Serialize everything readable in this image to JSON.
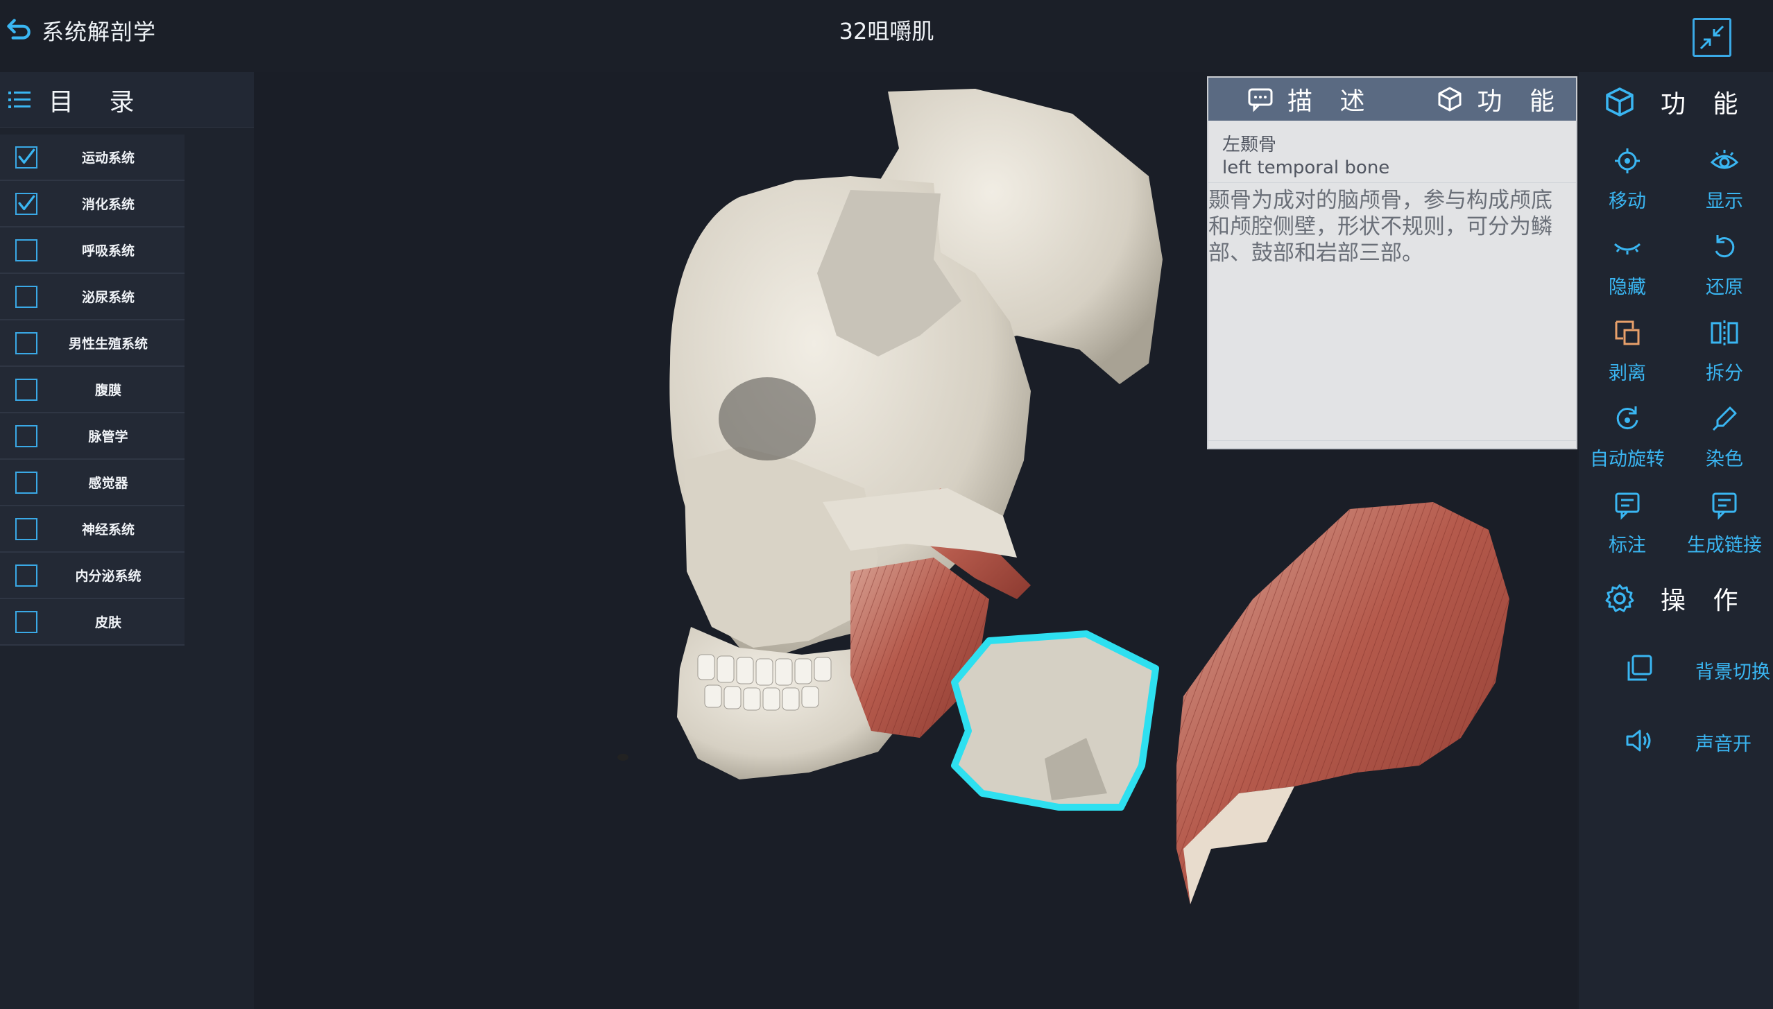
{
  "header": {
    "app_title": "系统解剖学",
    "page_title": "32咀嚼肌"
  },
  "toc": {
    "title": "目 录",
    "items": [
      {
        "label": "运动系统",
        "checked": true
      },
      {
        "label": "消化系统",
        "checked": true
      },
      {
        "label": "呼吸系统",
        "checked": false
      },
      {
        "label": "泌尿系统",
        "checked": false
      },
      {
        "label": "男性生殖系统",
        "checked": false
      },
      {
        "label": "腹膜",
        "checked": false
      },
      {
        "label": "脉管学",
        "checked": false
      },
      {
        "label": "感觉器",
        "checked": false
      },
      {
        "label": "神经系统",
        "checked": false
      },
      {
        "label": "内分泌系统",
        "checked": false
      },
      {
        "label": "皮肤",
        "checked": false
      }
    ]
  },
  "description": {
    "tabs": [
      "描 述",
      "功 能"
    ],
    "name_cn": "左颞骨",
    "name_en": "left temporal bone",
    "text": "颞骨为成对的脑颅骨，参与构成颅底和颅腔侧壁，形状不规则，可分为鳞部、鼓部和岩部三部。"
  },
  "right_panel": {
    "function_title": "功 能",
    "functions": [
      {
        "label": "移动",
        "icon": "move-target-icon"
      },
      {
        "label": "显示",
        "icon": "eye-icon"
      },
      {
        "label": "隐藏",
        "icon": "eye-closed-icon"
      },
      {
        "label": "还原",
        "icon": "restore-icon"
      },
      {
        "label": "剥离",
        "icon": "peel-icon"
      },
      {
        "label": "拆分",
        "icon": "split-icon"
      },
      {
        "label": "自动旋转",
        "icon": "auto-rotate-icon"
      },
      {
        "label": "染色",
        "icon": "dye-pipette-icon"
      },
      {
        "label": "标注",
        "icon": "annotate-icon"
      },
      {
        "label": "生成链接",
        "icon": "link-generate-icon"
      }
    ],
    "operation_title": "操 作",
    "operations": [
      {
        "label": "背景切换",
        "icon": "background-switch-icon"
      },
      {
        "label": "声音开",
        "icon": "speaker-icon"
      }
    ]
  },
  "colors": {
    "accent": "#3ab6f2",
    "peel_icon": "#e8a06a",
    "background": "#1b1f28",
    "selection_glow": "#2ee0f0"
  }
}
